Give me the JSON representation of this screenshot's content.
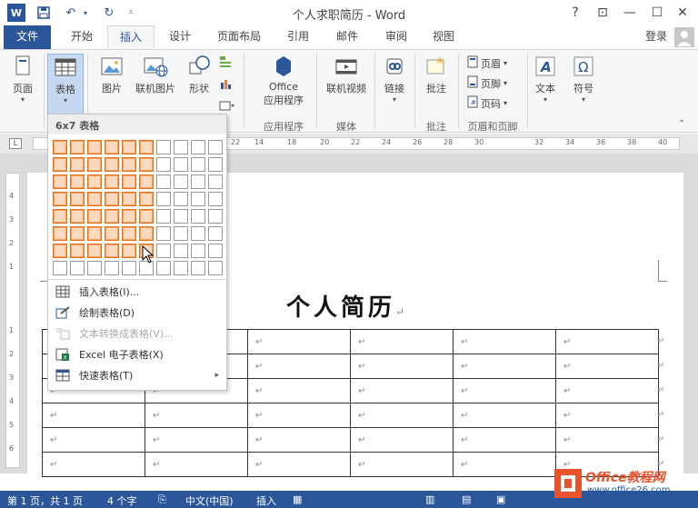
{
  "window": {
    "title": "个人求职简历 - Word",
    "help": "?",
    "restore_ribbon": "⊡",
    "minimize": "—",
    "maximize": "☐",
    "close": "✕"
  },
  "tabs": [
    {
      "label": "文件"
    },
    {
      "label": "开始"
    },
    {
      "label": "插入"
    },
    {
      "label": "设计"
    },
    {
      "label": "页面布局"
    },
    {
      "label": "引用"
    },
    {
      "label": "邮件"
    },
    {
      "label": "审阅"
    },
    {
      "label": "视图"
    }
  ],
  "login": "登录",
  "ribbon": {
    "page": "页面",
    "table": "表格",
    "picture": "图片",
    "online_picture": "联机图片",
    "shapes": "形状",
    "office_apps_line1": "Office",
    "office_apps_line2": "应用程序",
    "online_video": "联机视频",
    "link": "链接",
    "comment": "批注",
    "header": "页眉",
    "footer": "页脚",
    "page_number": "页码",
    "text": "文本",
    "symbol": "符号",
    "groups": {
      "apps": "应用程序",
      "media": "媒体",
      "comments": "批注",
      "header_footer": "页眉和页脚"
    }
  },
  "ruler": {
    "ticks": [
      "22",
      "14",
      "18",
      "20",
      "22",
      "24",
      "26",
      "28",
      "30",
      "32",
      "34",
      "36",
      "38",
      "40"
    ]
  },
  "dropdown": {
    "header": "6x7 表格",
    "grid_cols": 10,
    "grid_rows": 8,
    "highlight_cols": 6,
    "highlight_rows": 7,
    "items": [
      {
        "label": "插入表格(I)...",
        "disabled": false,
        "icon": "insert-table-icon"
      },
      {
        "label": "绘制表格(D)",
        "disabled": false,
        "icon": "draw-table-icon"
      },
      {
        "label": "文本转换成表格(V)...",
        "disabled": true,
        "icon": "text-to-table-icon"
      },
      {
        "label": "Excel 电子表格(X)",
        "disabled": false,
        "icon": "excel-icon"
      },
      {
        "label": "快速表格(T)",
        "disabled": false,
        "icon": "quick-table-icon"
      }
    ]
  },
  "document": {
    "title": "个人简历",
    "mark": "↵",
    "rows": 6,
    "cols": 6
  },
  "status": {
    "page": "第 1 页，共 1 页",
    "words": "4 个字",
    "language": "中文(中国)",
    "mode": "插入"
  },
  "watermark": {
    "line1": "Office教程网",
    "line2": "www.office26.com"
  },
  "colors": {
    "accent": "#2b579a",
    "highlight": "#fbd9be",
    "highlight_border": "#e86e1a"
  }
}
